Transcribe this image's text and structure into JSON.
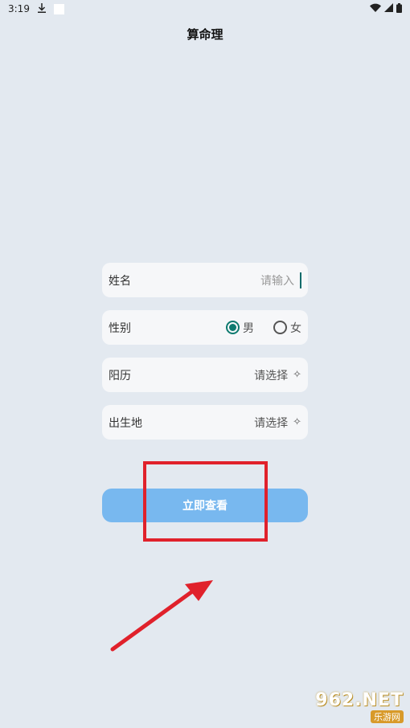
{
  "status_bar": {
    "time": "3:19"
  },
  "header": {
    "title": "算命理"
  },
  "form": {
    "name": {
      "label": "姓名",
      "placeholder": "请输入"
    },
    "gender": {
      "label": "性别",
      "male": "男",
      "female": "女",
      "selected": "男"
    },
    "birth_date": {
      "label": "阳历",
      "value": "请选择"
    },
    "birthplace": {
      "label": "出生地",
      "value": "请选择"
    }
  },
  "submit": {
    "label": "立即查看"
  },
  "watermark": {
    "top": "962.NET",
    "bottom": "乐游网"
  },
  "colors": {
    "background": "#e3e9f0",
    "button": "#78b8ef",
    "highlight": "#e0212b",
    "radio_accent": "#0e7a6f"
  },
  "icons": [
    "download-icon",
    "wifi-icon",
    "signal-icon",
    "battery-icon",
    "sparkle-icon",
    "arrow-annotation"
  ]
}
